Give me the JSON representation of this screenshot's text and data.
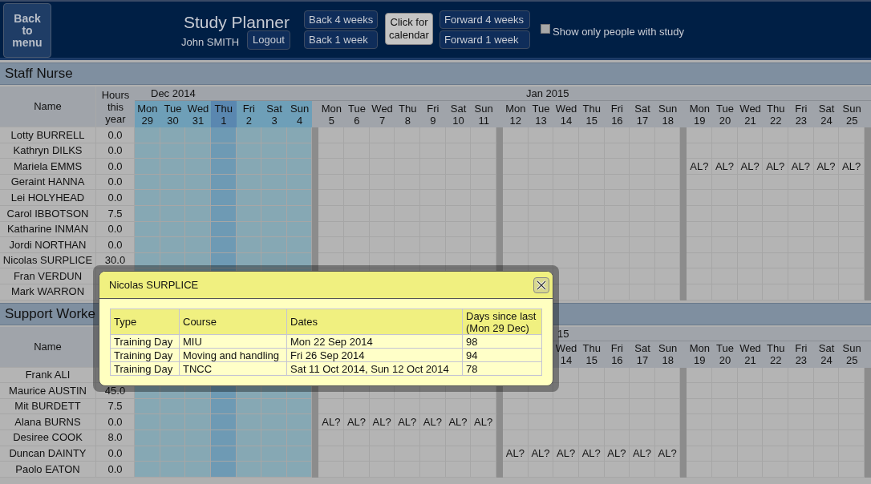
{
  "header": {
    "menu_button": "Back to menu",
    "title": "Study Planner",
    "user": "John SMITH",
    "logout": "Logout",
    "back_buttons": [
      "Back 4 weeks",
      "Back 1 week"
    ],
    "calendar_button": "Click for calendar",
    "forward_buttons": [
      "Forward 4 weeks",
      "Forward 1 week"
    ],
    "filter": {
      "label": "Show only people with study",
      "checked": false
    }
  },
  "sections": [
    {
      "title": "Staff Nurse",
      "name_header": "Name",
      "hours_header": "Hours this year",
      "months": [
        {
          "kind": "first",
          "label": "Dec 2014"
        },
        {
          "kind": "main",
          "label": "Jan 2015"
        }
      ],
      "days": [
        {
          "dow": "Mon",
          "day": "29",
          "kind": "current"
        },
        {
          "dow": "Tue",
          "day": "30",
          "kind": "current"
        },
        {
          "dow": "Wed",
          "day": "31",
          "kind": "current"
        },
        {
          "dow": "Thu",
          "day": "1",
          "kind": "today"
        },
        {
          "dow": "Fri",
          "day": "2",
          "kind": "current"
        },
        {
          "dow": "Sat",
          "day": "3",
          "kind": "current"
        },
        {
          "dow": "Sun",
          "day": "4",
          "kind": "current"
        },
        {
          "dow": "Mon",
          "day": "5",
          "kind": "normal"
        },
        {
          "dow": "Tue",
          "day": "6",
          "kind": "normal"
        },
        {
          "dow": "Wed",
          "day": "7",
          "kind": "normal"
        },
        {
          "dow": "Thu",
          "day": "8",
          "kind": "normal"
        },
        {
          "dow": "Fri",
          "day": "9",
          "kind": "normal"
        },
        {
          "dow": "Sat",
          "day": "10",
          "kind": "normal"
        },
        {
          "dow": "Sun",
          "day": "11",
          "kind": "normal"
        },
        {
          "dow": "Mon",
          "day": "12",
          "kind": "normal"
        },
        {
          "dow": "Tue",
          "day": "13",
          "kind": "normal"
        },
        {
          "dow": "Wed",
          "day": "14",
          "kind": "normal"
        },
        {
          "dow": "Thu",
          "day": "15",
          "kind": "normal"
        },
        {
          "dow": "Fri",
          "day": "16",
          "kind": "normal"
        },
        {
          "dow": "Sat",
          "day": "17",
          "kind": "normal"
        },
        {
          "dow": "Sun",
          "day": "18",
          "kind": "normal"
        },
        {
          "dow": "Mon",
          "day": "19",
          "kind": "normal"
        },
        {
          "dow": "Tue",
          "day": "20",
          "kind": "normal"
        },
        {
          "dow": "Wed",
          "day": "21",
          "kind": "normal"
        },
        {
          "dow": "Thu",
          "day": "22",
          "kind": "normal"
        },
        {
          "dow": "Fri",
          "day": "23",
          "kind": "normal"
        },
        {
          "dow": "Sat",
          "day": "24",
          "kind": "normal"
        },
        {
          "dow": "Sun",
          "day": "25",
          "kind": "normal"
        }
      ],
      "rows": [
        {
          "name": "Lotty BURRELL",
          "hours": "0.0"
        },
        {
          "name": "Kathryn DILKS",
          "hours": "0.0"
        },
        {
          "name": "Mariela EMMS",
          "hours": "0.0",
          "cells": [
            null,
            null,
            null,
            null,
            null,
            null,
            null,
            null,
            null,
            null,
            null,
            null,
            null,
            null,
            null,
            null,
            null,
            null,
            null,
            null,
            null,
            "AL?",
            "AL?",
            "AL?",
            "AL?",
            "AL?",
            "AL?",
            "AL?"
          ]
        },
        {
          "name": "Geraint HANNA",
          "hours": "0.0"
        },
        {
          "name": "Lei HOLYHEAD",
          "hours": "0.0"
        },
        {
          "name": "Carol IBBOTSON",
          "hours": "7.5"
        },
        {
          "name": "Katharine INMAN",
          "hours": "0.0"
        },
        {
          "name": "Jordi NORTHAN",
          "hours": "0.0"
        },
        {
          "name": "Nicolas SURPLICE",
          "hours": "30.0"
        },
        {
          "name": "Fran VERDUN"
        },
        {
          "name": "Mark WARRON"
        }
      ]
    },
    {
      "title": "Support Worke",
      "name_header": "Name",
      "months": [
        {
          "kind": "main",
          "label": "15"
        }
      ],
      "days": [
        {
          "kind": "current"
        },
        {
          "kind": "current"
        },
        {
          "kind": "current"
        },
        {
          "kind": "today"
        },
        {
          "kind": "current"
        },
        {
          "kind": "current"
        },
        {
          "kind": "current"
        },
        {
          "kind": "normal"
        },
        {
          "kind": "normal"
        },
        {
          "kind": "normal"
        },
        {
          "kind": "normal"
        },
        {
          "kind": "normal"
        },
        {
          "kind": "normal"
        },
        {
          "kind": "normal"
        },
        {
          "kind": "normal"
        },
        {
          "kind": "normal"
        },
        {
          "dow": "Wed",
          "day": "14",
          "kind": "normal"
        },
        {
          "dow": "Thu",
          "day": "15",
          "kind": "normal"
        },
        {
          "dow": "Fri",
          "day": "16",
          "kind": "normal"
        },
        {
          "dow": "Sat",
          "day": "17",
          "kind": "normal"
        },
        {
          "dow": "Sun",
          "day": "18",
          "kind": "normal"
        },
        {
          "dow": "Mon",
          "day": "19",
          "kind": "normal"
        },
        {
          "dow": "Tue",
          "day": "20",
          "kind": "normal"
        },
        {
          "dow": "Wed",
          "day": "21",
          "kind": "normal"
        },
        {
          "dow": "Thu",
          "day": "22",
          "kind": "normal"
        },
        {
          "dow": "Fri",
          "day": "23",
          "kind": "normal"
        },
        {
          "dow": "Sat",
          "day": "24",
          "kind": "normal"
        },
        {
          "dow": "Sun",
          "day": "25",
          "kind": "normal"
        }
      ],
      "rows": [
        {
          "name": "Frank ALI"
        },
        {
          "name": "Maurice AUSTIN",
          "hours": "45.0"
        },
        {
          "name": "Mit BURDETT",
          "hours": "7.5"
        },
        {
          "name": "Alana BURNS",
          "hours": "0.0",
          "cells": [
            null,
            null,
            null,
            null,
            null,
            null,
            null,
            "AL?",
            "AL?",
            "AL?",
            "AL?",
            "AL?",
            "AL?",
            "AL?"
          ]
        },
        {
          "name": "Desiree COOK",
          "hours": "8.0"
        },
        {
          "name": "Duncan DAINTY",
          "hours": "0.0",
          "cells": [
            null,
            null,
            null,
            null,
            null,
            null,
            null,
            null,
            null,
            null,
            null,
            null,
            null,
            null,
            "AL?",
            "AL?",
            "AL?",
            "AL?",
            "AL?",
            "AL?",
            "AL?"
          ]
        },
        {
          "name": "Paolo EATON",
          "hours": "0.0"
        }
      ]
    }
  ],
  "popup": {
    "title": "Nicolas SURPLICE",
    "columns": [
      "Type",
      "Course",
      "Dates",
      "Days since last (Mon 29 Dec)"
    ],
    "rows": [
      [
        "Training Day",
        "MIU",
        "Mon 22 Sep 2014",
        "98"
      ],
      [
        "Training Day",
        "Moving and handling",
        "Fri 26 Sep 2014",
        "94"
      ],
      [
        "Training Day",
        "TNCC",
        "Sat 11 Oct 2014, Sun 12 Oct 2014",
        "78"
      ]
    ]
  }
}
